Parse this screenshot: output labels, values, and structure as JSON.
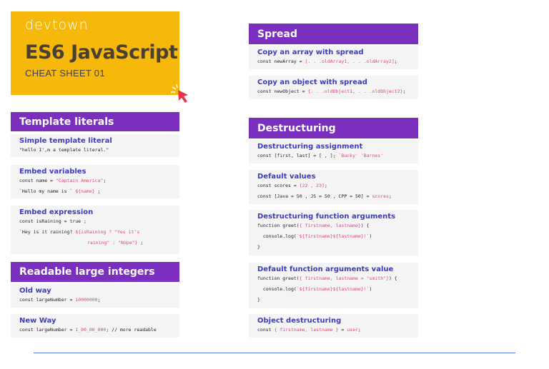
{
  "hero": {
    "brand": "devtown",
    "title": "ES6 JavaScript",
    "subtitle": "CHEAT SHEET 01"
  },
  "template_literals": {
    "header": "Template literals",
    "simple": {
      "title": "Simple template literal",
      "line1": "\"hello I',m a template literal.\""
    },
    "embed_vars": {
      "title": "Embed variables",
      "line1_a": "const name = ",
      "line1_b": "\"Captain America\"",
      "line1_c": ";",
      "line2_a": "`Hello my name is ` ",
      "line2_b": "${name}",
      "line2_c": " ;"
    },
    "embed_expr": {
      "title": "Embed expression",
      "line1": "const isRaining = true ;",
      "line2_a": "`Hey is it raining? ",
      "line2_b": "${isRaining ? \"Yes it's",
      "line3_b": "raining\" : \"Nope\"}",
      "line3_c": " ;"
    }
  },
  "readable_integers": {
    "header": "Readable large integers",
    "old": {
      "title": "Old way",
      "line1_a": "const largeNumber = ",
      "line1_b": "10000000",
      "line1_c": ";"
    },
    "new": {
      "title": "New Way",
      "line1_a": "const largeNumber = ",
      "line1_b": "1_00_00_000",
      "line1_c": "; // more readable"
    }
  },
  "spread": {
    "header": "Spread",
    "array": {
      "title": "Copy an array with spread",
      "line1_a": "const newArray = ",
      "line1_b": "[. . .oldArray1, . . .oldArray2]",
      "line1_c": ";"
    },
    "object": {
      "title": "Copy an object with spread",
      "line1_a": "const newObject = ",
      "line1_b": "{. . .oldObject1, . . .oldObject2}",
      "line1_c": ";"
    }
  },
  "destructuring": {
    "header": "Destructuring",
    "assignment": {
      "title": "Destructuring assignment",
      "line1_a": "const [first, last] = [ , ]; ",
      "line1_b": "`Bucky' 'Barnes'"
    },
    "defaults": {
      "title": "Default values",
      "line1_a": "const scores = ",
      "line1_b": "[22 , 23]",
      "line1_c": ";",
      "line2_a": "const [Java = 50 , JS = 50 , CPP = 50] = ",
      "line2_b": "scores",
      "line2_c": ";"
    },
    "func_args": {
      "title": "Destructuring function arguments",
      "line1_a": "function greet(",
      "line1_b": "{ firstname, lastname}",
      "line1_c": ") {",
      "line2_a": "  console.log(",
      "line2_b": "`${firstname}${lastname}!`",
      "line2_c": ")",
      "line3": "}"
    },
    "default_args": {
      "title": "Default function arguments value",
      "line1_a": "function greet(",
      "line1_b": "{ firstname, lastname = \"smith\"}",
      "line1_c": ") {",
      "line2_a": "  console.log(",
      "line2_b": "`${firstname}${lastname}!`",
      "line2_c": ")",
      "line3": "}"
    },
    "object": {
      "title": "Object destructuring",
      "line1_a": "const ",
      "line1_b": "{ firstname, lastname }",
      "line1_c": " = ",
      "line1_d": "user",
      "line1_e": ";"
    }
  },
  "colors": {
    "hero_bg": "#f6b80a",
    "header_bg": "#7b2fbe",
    "title_blue": "#3b3bc4",
    "code_pink": "#e0467a",
    "divider": "#5a78d8"
  }
}
